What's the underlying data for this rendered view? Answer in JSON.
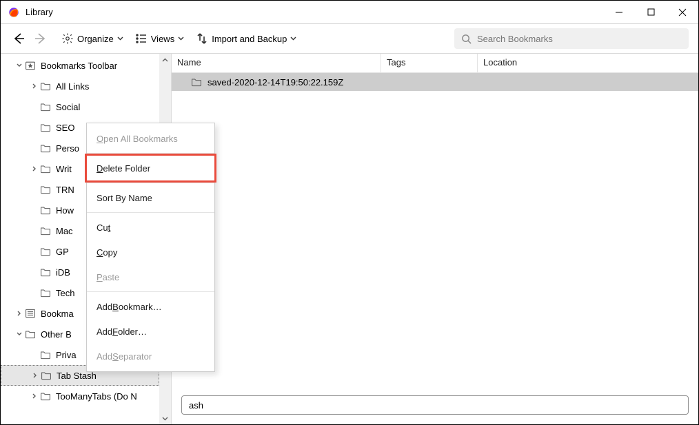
{
  "window": {
    "title": "Library"
  },
  "toolbar": {
    "organize": "Organize",
    "views": "Views",
    "import_backup": "Import and Backup",
    "search_placeholder": "Search Bookmarks"
  },
  "columns": {
    "name": "Name",
    "tags": "Tags",
    "location": "Location"
  },
  "sidebar": {
    "items": [
      {
        "label": "Bookmarks Toolbar",
        "depth": 0,
        "expand": "open",
        "icon": "star-folder"
      },
      {
        "label": "All Links",
        "depth": 1,
        "expand": "closed",
        "icon": "folder"
      },
      {
        "label": "Social",
        "depth": 1,
        "expand": "none",
        "icon": "folder"
      },
      {
        "label": "SEO",
        "depth": 1,
        "expand": "none",
        "icon": "folder"
      },
      {
        "label": "Perso",
        "depth": 1,
        "expand": "none",
        "icon": "folder"
      },
      {
        "label": "Writ",
        "depth": 1,
        "expand": "closed",
        "icon": "folder"
      },
      {
        "label": "TRN",
        "depth": 1,
        "expand": "none",
        "icon": "folder"
      },
      {
        "label": "How",
        "depth": 1,
        "expand": "none",
        "icon": "folder"
      },
      {
        "label": "Mac",
        "depth": 1,
        "expand": "none",
        "icon": "folder"
      },
      {
        "label": "GP",
        "depth": 1,
        "expand": "none",
        "icon": "folder"
      },
      {
        "label": "iDB",
        "depth": 1,
        "expand": "none",
        "icon": "folder"
      },
      {
        "label": "Tech",
        "depth": 1,
        "expand": "none",
        "icon": "folder"
      },
      {
        "label": "Bookma",
        "depth": 0,
        "expand": "closed",
        "icon": "menu-folder"
      },
      {
        "label": "Other B",
        "depth": 0,
        "expand": "open",
        "icon": "folder"
      },
      {
        "label": "Priva",
        "depth": 1,
        "expand": "none",
        "icon": "folder"
      },
      {
        "label": "Tab Stash",
        "depth": 1,
        "expand": "closed",
        "icon": "folder",
        "selected": true
      },
      {
        "label": "TooManyTabs (Do N",
        "depth": 1,
        "expand": "closed",
        "icon": "folder"
      }
    ]
  },
  "listing": {
    "rows": [
      {
        "name": "saved-2020-12-14T19:50:22.159Z"
      }
    ]
  },
  "editbar": {
    "value": "ash"
  },
  "context_menu": {
    "items": [
      {
        "label": "Open All Bookmarks",
        "disabled": true,
        "access": "O"
      },
      {
        "sep": true
      },
      {
        "label": "Delete Folder",
        "highlighted": true,
        "access": "D"
      },
      {
        "sep": true
      },
      {
        "label": "Sort By Name"
      },
      {
        "sep": true
      },
      {
        "label": "Cut",
        "access": "t"
      },
      {
        "label": "Copy",
        "access": "C"
      },
      {
        "label": "Paste",
        "disabled": true,
        "access": "P"
      },
      {
        "sep": true
      },
      {
        "label": "Add Bookmark…",
        "access": "B"
      },
      {
        "label": "Add Folder…",
        "access": "F"
      },
      {
        "label": "Add Separator",
        "disabled": true,
        "access": "S"
      }
    ]
  }
}
